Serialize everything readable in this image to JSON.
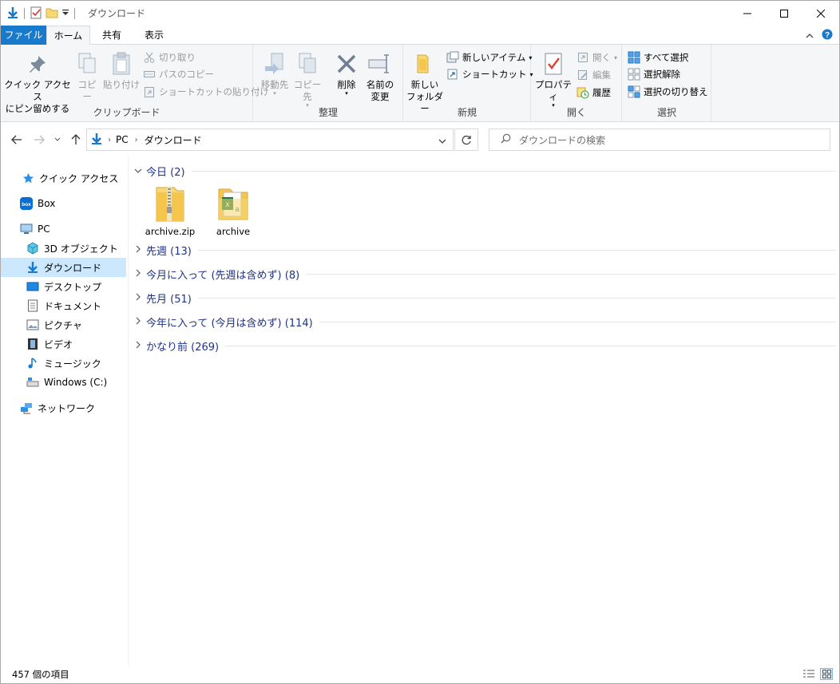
{
  "window": {
    "title": "ダウンロード"
  },
  "tabs": {
    "file": "ファイル",
    "home": "ホーム",
    "share": "共有",
    "view": "表示"
  },
  "ribbon": {
    "clipboard": {
      "label": "クリップボード",
      "pin_line1": "クイック アクセス",
      "pin_line2": "にピン留めする",
      "copy": "コピー",
      "paste": "貼り付け",
      "cut": "切り取り",
      "copy_path": "パスのコピー",
      "paste_shortcut": "ショートカットの貼り付け"
    },
    "organize": {
      "label": "整理",
      "move_to": "移動先",
      "copy_to": "コピー先",
      "delete": "削除",
      "rename_line1": "名前の",
      "rename_line2": "変更"
    },
    "new": {
      "label": "新規",
      "new_folder_line1": "新しい",
      "new_folder_line2": "フォルダー",
      "new_item": "新しいアイテム",
      "easy_access": "ショートカット"
    },
    "open": {
      "label": "開く",
      "properties": "プロパティ",
      "open": "開く",
      "edit": "編集",
      "history": "履歴"
    },
    "select": {
      "label": "選択",
      "select_all": "すべて選択",
      "select_none": "選択解除",
      "invert": "選択の切り替え"
    }
  },
  "address": {
    "pc": "PC",
    "current": "ダウンロード"
  },
  "search": {
    "placeholder": "ダウンロードの検索"
  },
  "nav": {
    "quick_access": "クイック アクセス",
    "box": "Box",
    "pc": "PC",
    "objects3d": "3D オブジェクト",
    "downloads": "ダウンロード",
    "desktop": "デスクトップ",
    "documents": "ドキュメント",
    "pictures": "ピクチャ",
    "videos": "ビデオ",
    "music": "ミュージック",
    "windows_c": "Windows (C:)",
    "network": "ネットワーク"
  },
  "groups": [
    {
      "label": "今日 (2)",
      "expanded": true
    },
    {
      "label": "先週 (13)",
      "expanded": false
    },
    {
      "label": "今月に入って (先週は含めず) (8)",
      "expanded": false
    },
    {
      "label": "先月 (51)",
      "expanded": false
    },
    {
      "label": "今年に入って (今月は含めず) (114)",
      "expanded": false
    },
    {
      "label": "かなり前 (269)",
      "expanded": false
    }
  ],
  "files": [
    {
      "name": "archive.zip",
      "icon": "zip-folder-icon"
    },
    {
      "name": "archive",
      "icon": "folder-excel-icon"
    }
  ],
  "status": {
    "item_count": "457 個の項目"
  },
  "colors": {
    "accent": "#1979ca",
    "selection": "#cce8ff",
    "group_text": "#1e3287"
  }
}
